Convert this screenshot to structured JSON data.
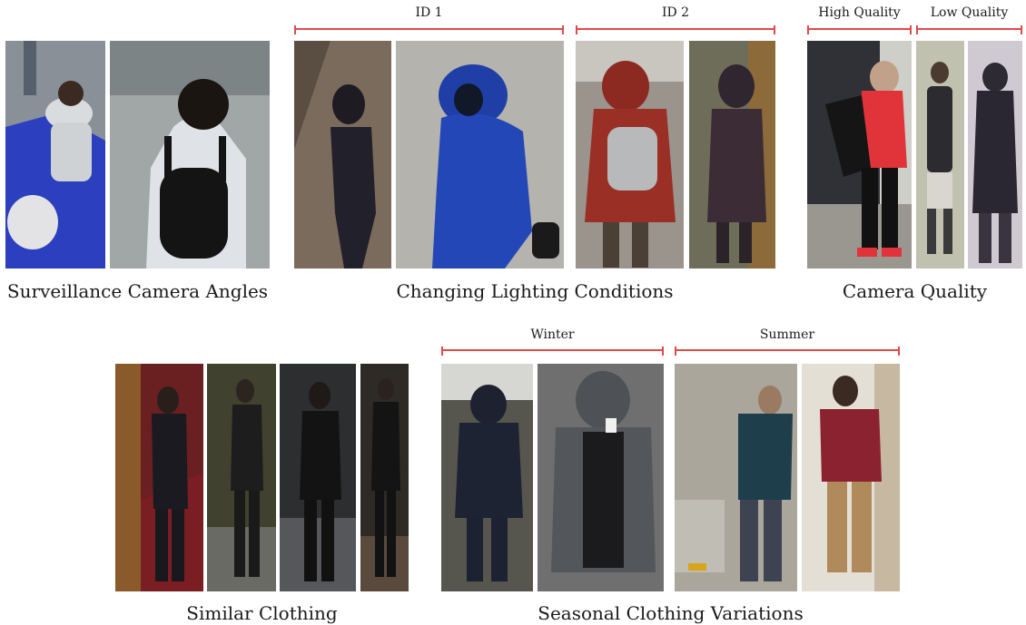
{
  "colors": {
    "bracket": "#e04a4a",
    "caption_text": "#1a1a1a"
  },
  "row1": {
    "surveillance": {
      "caption": "Surveillance Camera Angles"
    },
    "lighting": {
      "caption": "Changing Lighting Conditions",
      "groups": [
        "ID 1",
        "ID 2"
      ]
    },
    "quality": {
      "caption": "Camera Quality",
      "groups": [
        "High Quality",
        "Low Quality"
      ]
    }
  },
  "row2": {
    "similar": {
      "caption": "Similar Clothing"
    },
    "seasonal": {
      "caption": "Seasonal Clothing Variations",
      "groups": [
        "Winter",
        "Summer"
      ]
    }
  }
}
